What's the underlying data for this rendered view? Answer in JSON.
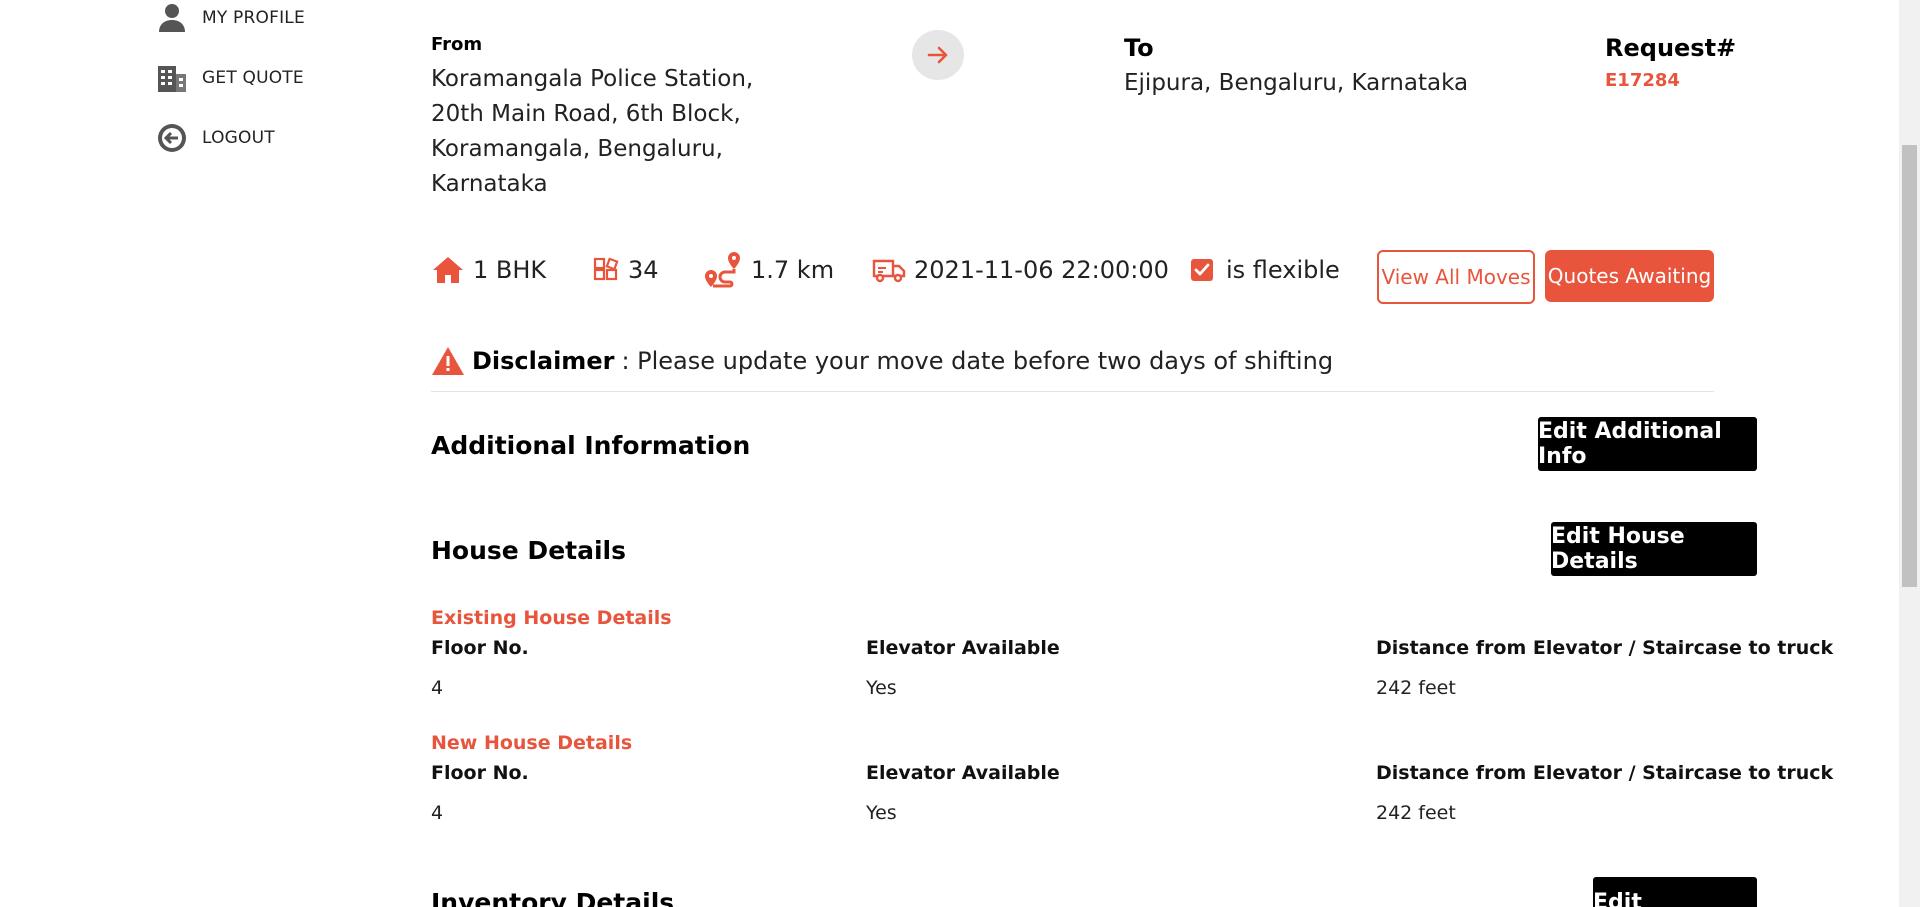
{
  "sidebar": {
    "items": [
      {
        "label": "MY PROFILE",
        "icon": "user-icon"
      },
      {
        "label": "GET QUOTE",
        "icon": "quote-building-icon"
      },
      {
        "label": "LOGOUT",
        "icon": "logout-icon"
      }
    ]
  },
  "move": {
    "from_label": "From",
    "from_address": "Koramangala Police Station, 20th Main Road, 6th Block, Koramangala, Bengaluru, Karnataka",
    "to_label": "To",
    "to_address": "Ejipura, Bengaluru, Karnataka",
    "request_label": "Request#",
    "request_number": "E17284"
  },
  "stats": {
    "house_type": "1 BHK",
    "item_count": "34",
    "distance": "1.7 km",
    "datetime": "2021-11-06 22:00:00",
    "flexible_label": "is flexible"
  },
  "actions": {
    "view_all_moves": "View All Moves",
    "quotes_awaiting": "Quotes Awaiting"
  },
  "disclaimer": {
    "title": "Disclaimer",
    "text": ": Please update your move date before two days of shifting"
  },
  "additional_info": {
    "title": "Additional Information",
    "edit_button": "Edit Additional Info"
  },
  "house_details": {
    "title": "House Details",
    "edit_button": "Edit House Details",
    "existing": {
      "title": "Existing House Details",
      "floor_label": "Floor No.",
      "floor_value": "4",
      "elevator_label": "Elevator Available",
      "elevator_value": "Yes",
      "distance_label": "Distance from Elevator / Staircase to truck",
      "distance_value": "242 feet"
    },
    "new": {
      "title": "New House Details",
      "floor_label": "Floor No.",
      "floor_value": "4",
      "elevator_label": "Elevator Available",
      "elevator_value": "Yes",
      "distance_label": "Distance from Elevator / Staircase to truck",
      "distance_value": "242 feet"
    }
  },
  "inventory": {
    "title": "Inventory Details",
    "edit_button": "Edit Inventory"
  },
  "colors": {
    "accent": "#e8553c",
    "black": "#000000"
  }
}
